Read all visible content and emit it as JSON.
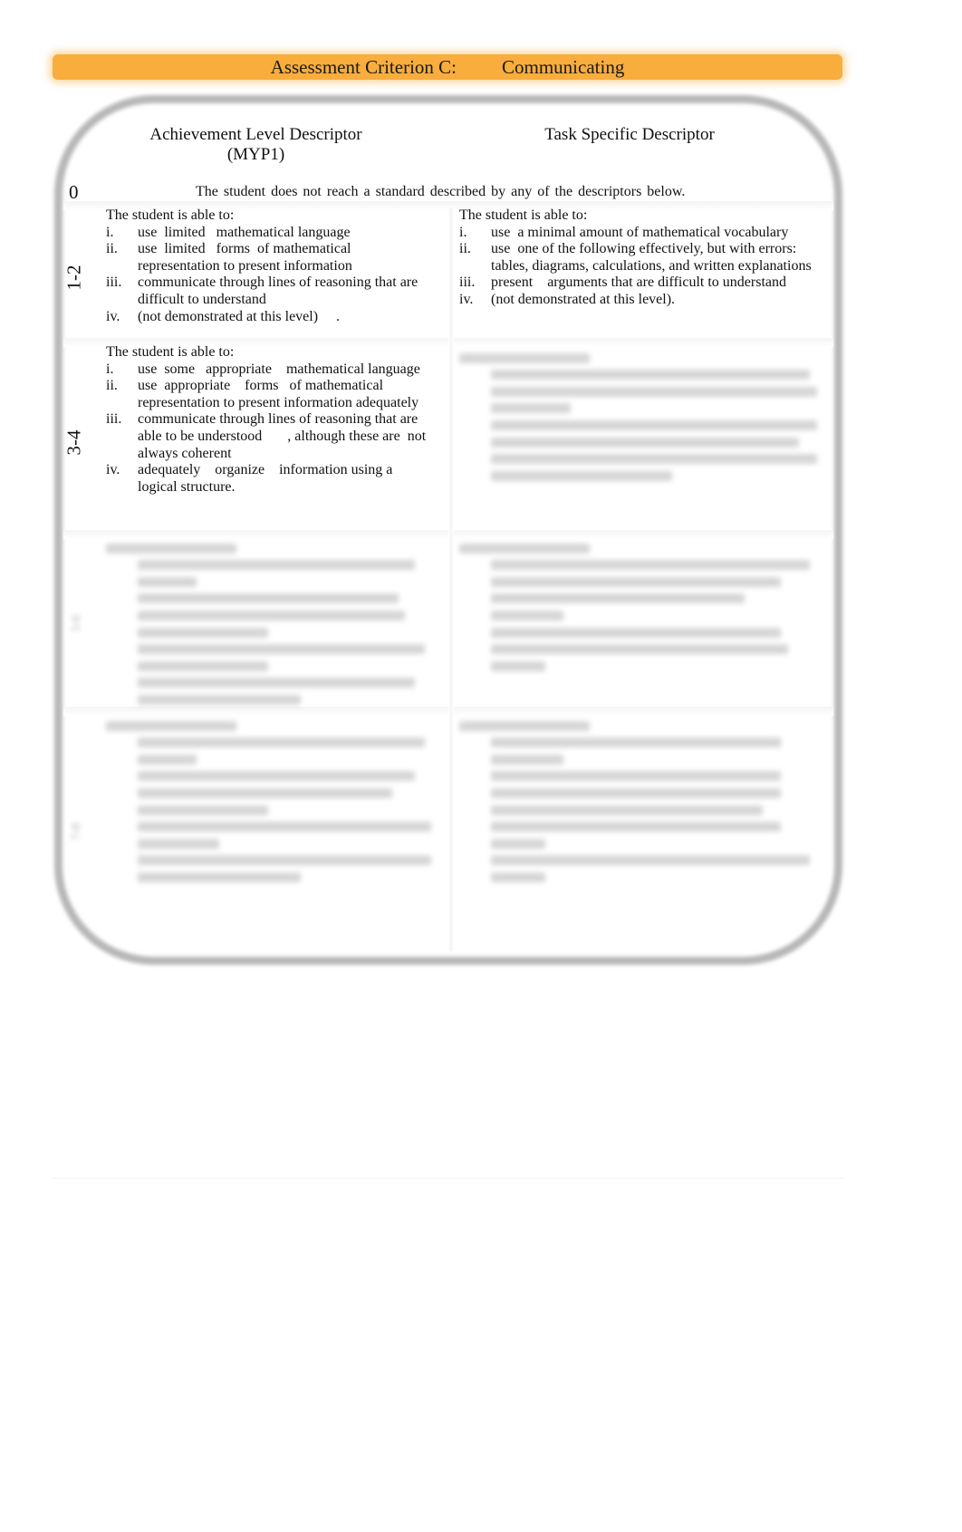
{
  "header": {
    "criterion": "Assessment Criterion C:",
    "title": "Communicating",
    "accent_color": "#f8ad3c"
  },
  "columns": {
    "left_heading": "Achievement Level Descriptor",
    "left_subheading": "(MYP1)",
    "right_heading": "Task Specific Descriptor"
  },
  "levels": [
    {
      "level": "0",
      "text": "The student   does   not  reach a standard described by any of the descriptors below."
    },
    {
      "level": "1-2",
      "achievement": {
        "intro": "The student is able to:",
        "items": [
          {
            "num": "i.",
            "text": "use  limited   mathematical language"
          },
          {
            "num": "ii.",
            "text": "use  limited   forms  of mathematical representation to present information"
          },
          {
            "num": "iii.",
            "text": "communicate through lines of reasoning that are  difficult to understand"
          },
          {
            "num": "iv.",
            "text": "(not demonstrated at this level)     ."
          }
        ]
      },
      "task_specific": {
        "intro": "The student is able to:",
        "items": [
          {
            "num": "i.",
            "text": "use  a minimal amount of mathematical vocabulary"
          },
          {
            "num": "ii.",
            "text": "use  one of the following effectively, but with errors: tables, diagrams, calculations, and written explanations"
          },
          {
            "num": "iii.",
            "text": "present    arguments that are difficult to understand"
          },
          {
            "num": "iv.",
            "text": "(not demonstrated at this level)."
          }
        ]
      }
    },
    {
      "level": "3-4",
      "achievement": {
        "intro": "The student is able to:",
        "items": [
          {
            "num": "i.",
            "text": "use  some   appropriate    mathematical language"
          },
          {
            "num": "ii.",
            "text": "use  appropriate    forms   of mathematical representation to present information adequately"
          },
          {
            "num": "iii.",
            "text": "communicate through lines of reasoning that are  able to be understood       , although these are  not always coherent"
          },
          {
            "num": "iv.",
            "text": "adequately    organize    information using a logical structure."
          }
        ]
      },
      "task_specific": {
        "blurred": true
      }
    },
    {
      "level": "5-6",
      "blurred": true
    },
    {
      "level": "7-8",
      "blurred": true
    }
  ]
}
